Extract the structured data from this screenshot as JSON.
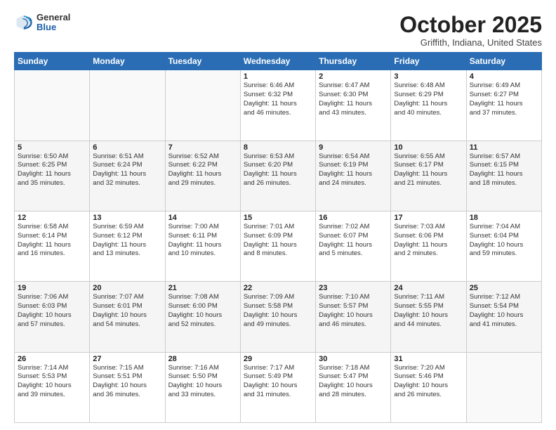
{
  "header": {
    "logo": {
      "general": "General",
      "blue": "Blue"
    },
    "title": "October 2025",
    "location": "Griffith, Indiana, United States"
  },
  "weekdays": [
    "Sunday",
    "Monday",
    "Tuesday",
    "Wednesday",
    "Thursday",
    "Friday",
    "Saturday"
  ],
  "weeks": [
    [
      {
        "day": "",
        "info": ""
      },
      {
        "day": "",
        "info": ""
      },
      {
        "day": "",
        "info": ""
      },
      {
        "day": "1",
        "info": "Sunrise: 6:46 AM\nSunset: 6:32 PM\nDaylight: 11 hours\nand 46 minutes."
      },
      {
        "day": "2",
        "info": "Sunrise: 6:47 AM\nSunset: 6:30 PM\nDaylight: 11 hours\nand 43 minutes."
      },
      {
        "day": "3",
        "info": "Sunrise: 6:48 AM\nSunset: 6:29 PM\nDaylight: 11 hours\nand 40 minutes."
      },
      {
        "day": "4",
        "info": "Sunrise: 6:49 AM\nSunset: 6:27 PM\nDaylight: 11 hours\nand 37 minutes."
      }
    ],
    [
      {
        "day": "5",
        "info": "Sunrise: 6:50 AM\nSunset: 6:25 PM\nDaylight: 11 hours\nand 35 minutes."
      },
      {
        "day": "6",
        "info": "Sunrise: 6:51 AM\nSunset: 6:24 PM\nDaylight: 11 hours\nand 32 minutes."
      },
      {
        "day": "7",
        "info": "Sunrise: 6:52 AM\nSunset: 6:22 PM\nDaylight: 11 hours\nand 29 minutes."
      },
      {
        "day": "8",
        "info": "Sunrise: 6:53 AM\nSunset: 6:20 PM\nDaylight: 11 hours\nand 26 minutes."
      },
      {
        "day": "9",
        "info": "Sunrise: 6:54 AM\nSunset: 6:19 PM\nDaylight: 11 hours\nand 24 minutes."
      },
      {
        "day": "10",
        "info": "Sunrise: 6:55 AM\nSunset: 6:17 PM\nDaylight: 11 hours\nand 21 minutes."
      },
      {
        "day": "11",
        "info": "Sunrise: 6:57 AM\nSunset: 6:15 PM\nDaylight: 11 hours\nand 18 minutes."
      }
    ],
    [
      {
        "day": "12",
        "info": "Sunrise: 6:58 AM\nSunset: 6:14 PM\nDaylight: 11 hours\nand 16 minutes."
      },
      {
        "day": "13",
        "info": "Sunrise: 6:59 AM\nSunset: 6:12 PM\nDaylight: 11 hours\nand 13 minutes."
      },
      {
        "day": "14",
        "info": "Sunrise: 7:00 AM\nSunset: 6:11 PM\nDaylight: 11 hours\nand 10 minutes."
      },
      {
        "day": "15",
        "info": "Sunrise: 7:01 AM\nSunset: 6:09 PM\nDaylight: 11 hours\nand 8 minutes."
      },
      {
        "day": "16",
        "info": "Sunrise: 7:02 AM\nSunset: 6:07 PM\nDaylight: 11 hours\nand 5 minutes."
      },
      {
        "day": "17",
        "info": "Sunrise: 7:03 AM\nSunset: 6:06 PM\nDaylight: 11 hours\nand 2 minutes."
      },
      {
        "day": "18",
        "info": "Sunrise: 7:04 AM\nSunset: 6:04 PM\nDaylight: 10 hours\nand 59 minutes."
      }
    ],
    [
      {
        "day": "19",
        "info": "Sunrise: 7:06 AM\nSunset: 6:03 PM\nDaylight: 10 hours\nand 57 minutes."
      },
      {
        "day": "20",
        "info": "Sunrise: 7:07 AM\nSunset: 6:01 PM\nDaylight: 10 hours\nand 54 minutes."
      },
      {
        "day": "21",
        "info": "Sunrise: 7:08 AM\nSunset: 6:00 PM\nDaylight: 10 hours\nand 52 minutes."
      },
      {
        "day": "22",
        "info": "Sunrise: 7:09 AM\nSunset: 5:58 PM\nDaylight: 10 hours\nand 49 minutes."
      },
      {
        "day": "23",
        "info": "Sunrise: 7:10 AM\nSunset: 5:57 PM\nDaylight: 10 hours\nand 46 minutes."
      },
      {
        "day": "24",
        "info": "Sunrise: 7:11 AM\nSunset: 5:55 PM\nDaylight: 10 hours\nand 44 minutes."
      },
      {
        "day": "25",
        "info": "Sunrise: 7:12 AM\nSunset: 5:54 PM\nDaylight: 10 hours\nand 41 minutes."
      }
    ],
    [
      {
        "day": "26",
        "info": "Sunrise: 7:14 AM\nSunset: 5:53 PM\nDaylight: 10 hours\nand 39 minutes."
      },
      {
        "day": "27",
        "info": "Sunrise: 7:15 AM\nSunset: 5:51 PM\nDaylight: 10 hours\nand 36 minutes."
      },
      {
        "day": "28",
        "info": "Sunrise: 7:16 AM\nSunset: 5:50 PM\nDaylight: 10 hours\nand 33 minutes."
      },
      {
        "day": "29",
        "info": "Sunrise: 7:17 AM\nSunset: 5:49 PM\nDaylight: 10 hours\nand 31 minutes."
      },
      {
        "day": "30",
        "info": "Sunrise: 7:18 AM\nSunset: 5:47 PM\nDaylight: 10 hours\nand 28 minutes."
      },
      {
        "day": "31",
        "info": "Sunrise: 7:20 AM\nSunset: 5:46 PM\nDaylight: 10 hours\nand 26 minutes."
      },
      {
        "day": "",
        "info": ""
      }
    ]
  ]
}
